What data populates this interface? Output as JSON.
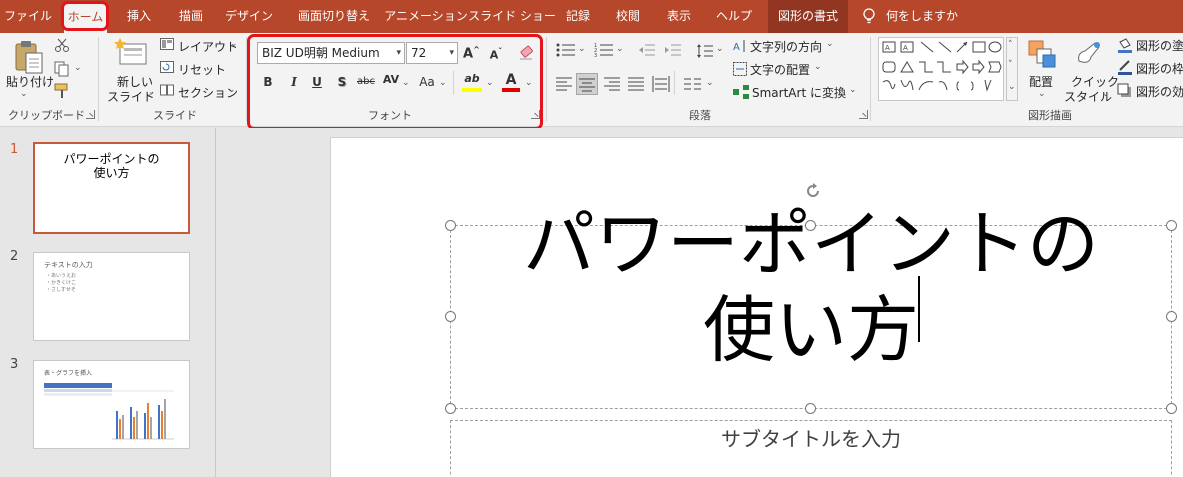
{
  "tabs": [
    {
      "label": "ファイル"
    },
    {
      "label": "ホーム",
      "active": true
    },
    {
      "label": "挿入"
    },
    {
      "label": "描画"
    },
    {
      "label": "デザイン"
    },
    {
      "label": "画面切り替え"
    },
    {
      "label": "アニメーション"
    },
    {
      "label": "スライド ショー"
    },
    {
      "label": "記録"
    },
    {
      "label": "校閲"
    },
    {
      "label": "表示"
    },
    {
      "label": "ヘルプ"
    },
    {
      "label": "図形の書式"
    }
  ],
  "tell_me": "何をしますか",
  "colors": {
    "brand": "#b7472a",
    "highlight_box": "#e5141b",
    "text_highlight": "#ffff00",
    "font_color": "#e00000",
    "selected_thumb": "#c55a3c"
  },
  "ribbon": {
    "clipboard": {
      "paste": "貼り付け",
      "label": "クリップボード"
    },
    "slides": {
      "new_slide_1": "新しい",
      "new_slide_2": "スライド",
      "layout": "レイアウト",
      "reset": "リセット",
      "section": "セクション",
      "label": "スライド"
    },
    "font": {
      "font_name": "BIZ UD明朝 Medium",
      "font_size": "72",
      "grow": "A",
      "shrink": "A",
      "bold": "B",
      "italic": "I",
      "underline": "U",
      "shadow": "S",
      "strike": "abc",
      "spacing": "AV",
      "case": "Aa",
      "highlight": "ab",
      "color": "A",
      "label": "フォント"
    },
    "paragraph": {
      "label": "段落"
    },
    "text_tools": {
      "direction": "文字列の方向",
      "align": "文字の配置",
      "smartart": "SmartArt に変換"
    },
    "drawing": {
      "arrange": "配置",
      "quick_1": "クイック",
      "quick_2": "スタイル",
      "fill": "図形の塗",
      "outline": "図形の枠",
      "effect": "図形の効",
      "label": "図形描画"
    }
  },
  "thumbnails": [
    {
      "number": "1",
      "title": "パワーポイントの\n使い方"
    },
    {
      "number": "2",
      "title": "テキストの入力",
      "bullets": [
        "・あいうえお",
        "・かきくけこ",
        "・さしすせそ"
      ]
    },
    {
      "number": "3",
      "title": "表・グラフを挿入"
    }
  ],
  "slide": {
    "title_line1": "パワーポイントの",
    "title_line2": "使い方",
    "subtitle": "サブタイトルを入力"
  }
}
